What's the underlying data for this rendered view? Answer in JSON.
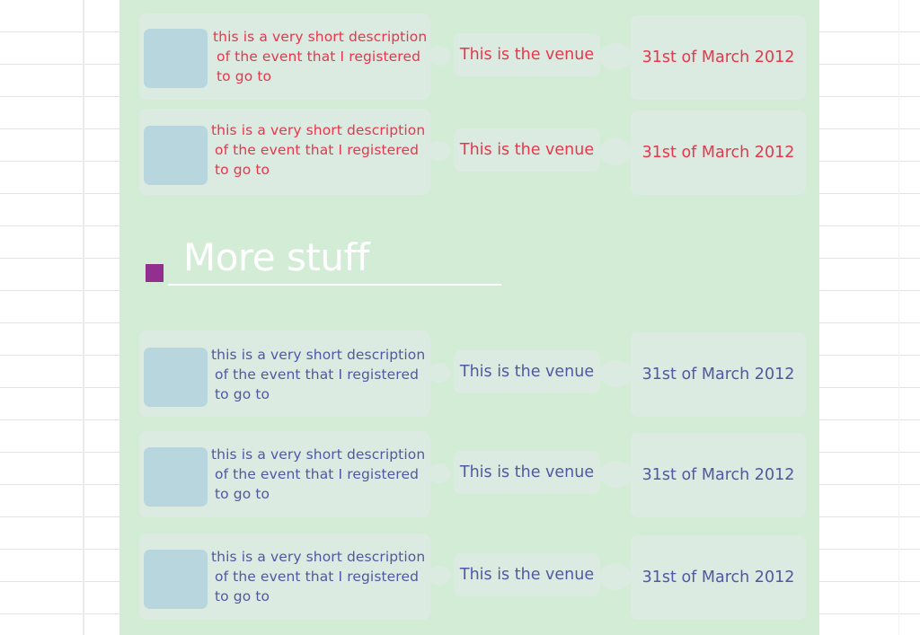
{
  "section_title": "More stuff",
  "colors": {
    "upcoming_text": "#e8364b",
    "more_text": "#4f58a3",
    "accent": "#93308f",
    "panel": "#d3ecd5"
  },
  "events_top": [
    {
      "desc": [
        "this is a very short description",
        "of the event that I registered",
        "to go to"
      ],
      "venue": "This is the venue",
      "date": "31st of March 2012"
    },
    {
      "desc": [
        "this is a very short description",
        "of the event that I registered",
        "to go to"
      ],
      "venue": "This is the venue",
      "date": "31st of March 2012"
    }
  ],
  "events_more": [
    {
      "desc": [
        "this is a very short description",
        "of the event that I registered",
        "to go to"
      ],
      "venue": "This is the venue",
      "date": "31st of March 2012"
    },
    {
      "desc": [
        "this is a very short description",
        "of the event that I registered",
        "to go to"
      ],
      "venue": "This is the venue",
      "date": "31st of March 2012"
    },
    {
      "desc": [
        "this is a very short description",
        "of the event that I registered",
        "to go to"
      ],
      "venue": "This is the venue",
      "date": "31st of March 2012"
    }
  ]
}
